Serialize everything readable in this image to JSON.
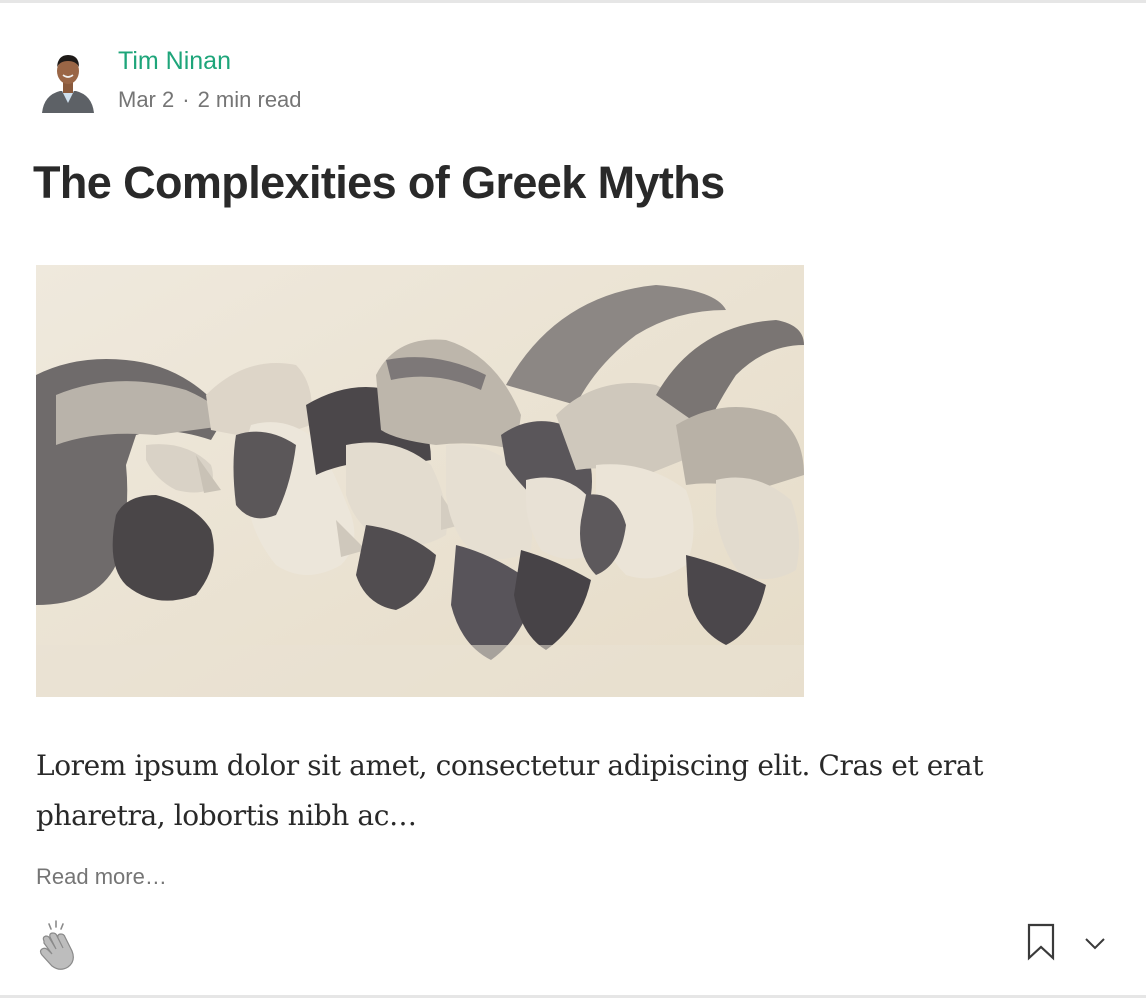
{
  "post": {
    "author": {
      "name": "Tim Ninan",
      "date": "Mar 2",
      "separator": "·",
      "read_time": "2 min read"
    },
    "title": "The Complexities of Greek Myths",
    "excerpt": "Lorem ipsum dolor sit amet, consectetur adipiscing elit. Cras et erat pharetra, lobortis nibh ac…",
    "read_more_label": "Read more…"
  },
  "colors": {
    "author_name": "#1ea57a",
    "meta": "#757575",
    "title": "#292929",
    "border": "#e6e6e6"
  },
  "icons": {
    "clap": "clap-icon",
    "bookmark": "bookmark-icon",
    "more": "chevron-down-icon"
  }
}
